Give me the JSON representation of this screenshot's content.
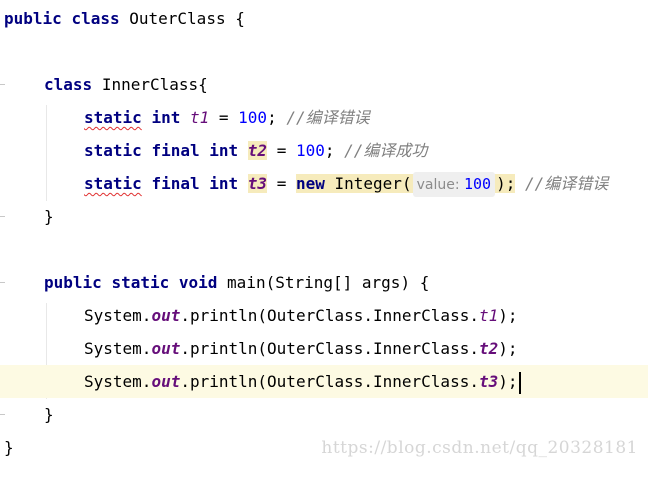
{
  "editor": {
    "lines": {
      "l1": [
        "public",
        "class",
        "OuterClass {"
      ],
      "l3": [
        "class",
        "InnerClass{"
      ],
      "l4": [
        "static",
        "int",
        "t1",
        " = ",
        "100",
        "; ",
        "//编译错误"
      ],
      "l5": [
        "static",
        "final",
        "int",
        "t2",
        " = ",
        "100",
        "; ",
        "//编译成功"
      ],
      "l6": [
        "static",
        "final",
        "int",
        "t3",
        " = ",
        "new",
        " Integer(",
        "value:",
        "100",
        ");",
        "//编译错误"
      ],
      "l7": [
        "}"
      ],
      "l9": [
        "public",
        "static",
        "void",
        "main(String[] args) {"
      ],
      "l10": [
        "System.",
        "out",
        ".println(OuterClass.InnerClass.",
        "t1",
        ");"
      ],
      "l11": [
        "System.",
        "out",
        ".println(OuterClass.InnerClass.",
        "t2",
        ");"
      ],
      "l12": [
        "System.",
        "out",
        ".println(OuterClass.InnerClass.",
        "t3",
        ");"
      ],
      "l13": [
        "}"
      ],
      "l14": [
        "}"
      ]
    }
  },
  "watermark": "https://blog.csdn.net/qq_20328181",
  "colors": {
    "keyword": "#000080",
    "static_field": "#660e7a",
    "number": "#0000ff",
    "comment": "#808080",
    "error_underline": "#e03030",
    "current_line": "#fdfae3",
    "identifier_highlight": "#f6ebbc"
  }
}
